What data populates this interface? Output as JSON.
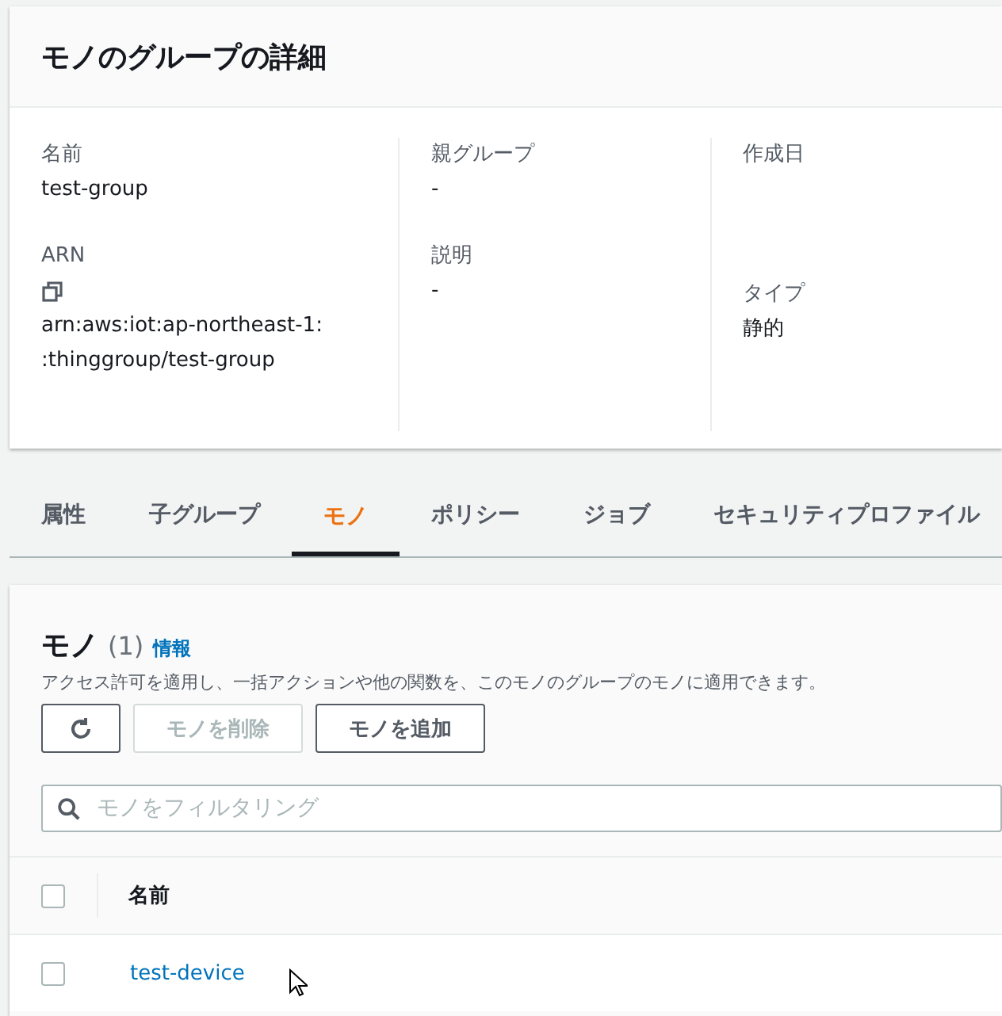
{
  "details": {
    "title": "モノのグループの詳細",
    "columns": [
      [
        {
          "label": "名前",
          "value": "test-group"
        },
        {
          "label": "ARN",
          "kind": "arn",
          "value_prefix": "arn:aws:iot:ap-northeast-1:",
          "value_suffix": ":thinggroup/test-group"
        }
      ],
      [
        {
          "label": "親グループ",
          "value": "-"
        },
        {
          "label": "説明",
          "value": "-"
        }
      ],
      [
        {
          "label": "作成日"
        },
        {
          "label": "タイプ",
          "value": "静的"
        }
      ]
    ]
  },
  "tabs": [
    {
      "label": "属性",
      "selected": false
    },
    {
      "label": "子グループ",
      "selected": false
    },
    {
      "label": "モノ",
      "selected": true
    },
    {
      "label": "ポリシー",
      "selected": false
    },
    {
      "label": "ジョブ",
      "selected": false
    },
    {
      "label": "セキュリティプロファイル",
      "selected": false
    }
  ],
  "things": {
    "title": "モノ",
    "count": "(1)",
    "info": "情報",
    "description": "アクセス許可を適用し、一括アクションや他の関数を、このモノのグループのモノに適用できます。",
    "buttons": [
      {
        "kind": "refresh",
        "disabled": false
      },
      {
        "kind": "text",
        "label": "モノを削除",
        "disabled": true
      },
      {
        "kind": "text",
        "label": "モノを追加",
        "disabled": false
      }
    ],
    "search": {
      "placeholder": "モノをフィルタリング"
    },
    "table": {
      "all_checked": false,
      "columns": [
        "名前"
      ],
      "rows": [
        {
          "name": "test-device",
          "checked": false
        }
      ]
    }
  }
}
